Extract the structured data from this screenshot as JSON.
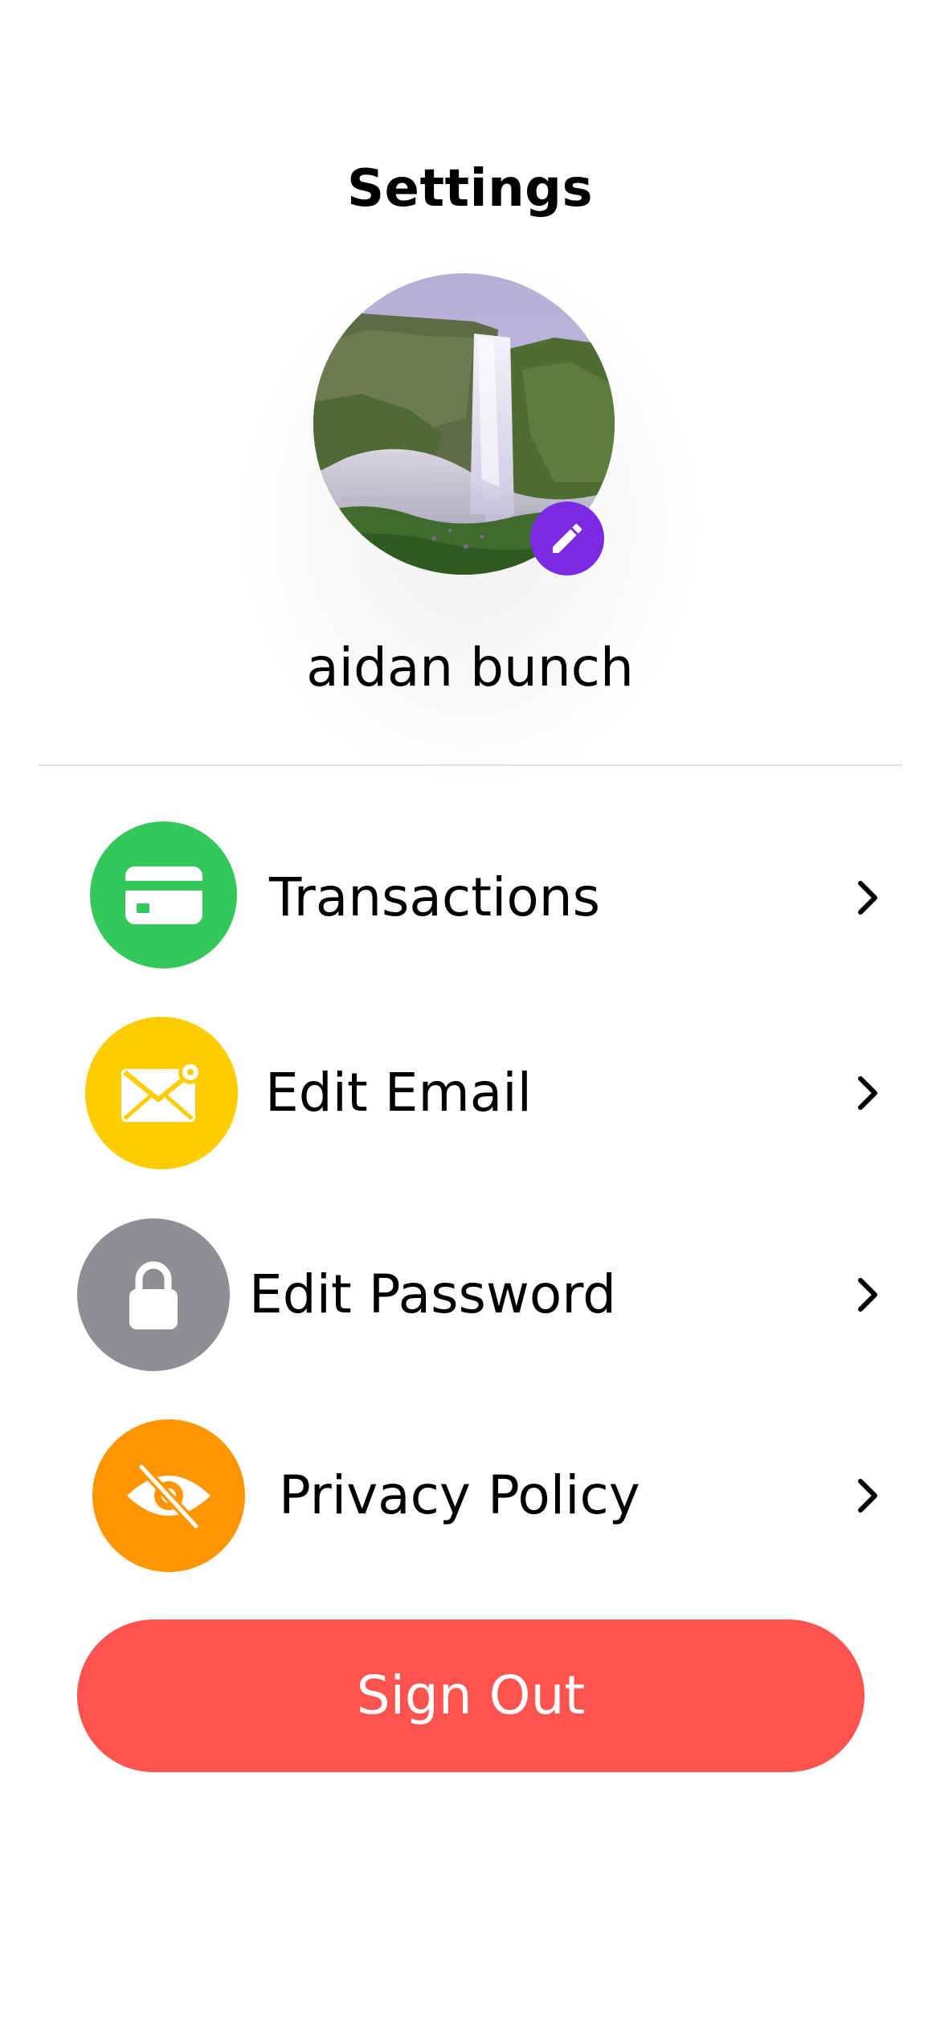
{
  "header": {
    "title": "Settings"
  },
  "profile": {
    "name": "aidan bunch",
    "avatar_icon": "waterfall-photo",
    "edit_icon": "pencil-icon",
    "edit_badge_color": "#7a2be2"
  },
  "menu": {
    "items": [
      {
        "label": "Transactions",
        "icon": "credit-card-icon",
        "color": "#34c759"
      },
      {
        "label": "Edit Email",
        "icon": "email-icon",
        "color": "#ffcc00"
      },
      {
        "label": "Edit Password",
        "icon": "lock-icon",
        "color": "#8e8e93"
      },
      {
        "label": "Privacy Policy",
        "icon": "eye-slash-icon",
        "color": "#ff9500"
      }
    ],
    "chevron_icon": "chevron-right-icon"
  },
  "actions": {
    "sign_out_label": "Sign Out",
    "sign_out_color": "#fe534e"
  }
}
